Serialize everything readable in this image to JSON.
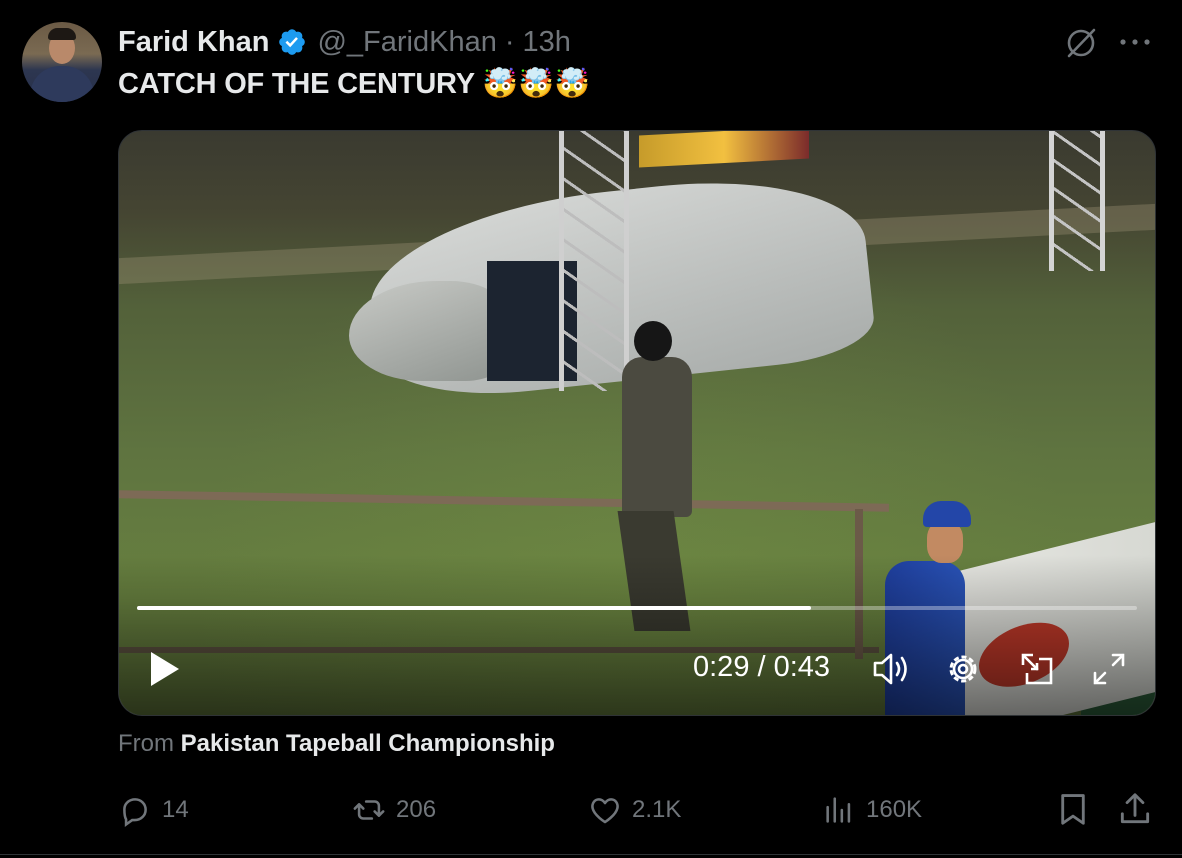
{
  "author": {
    "name": "Farid Khan",
    "handle": "@_FaridKhan",
    "separator": "·",
    "time": "13h",
    "verified": true
  },
  "tweet": {
    "text": "CATCH OF THE CENTURY",
    "emojis": "🤯🤯🤯"
  },
  "video": {
    "current_time": "0:29",
    "duration": "0:43",
    "timecode": "0:29 / 0:43",
    "progress_fraction": 0.674,
    "playing": false
  },
  "source": {
    "prefix": "From",
    "name": "Pakistan Tapeball Championship"
  },
  "actions": {
    "replies": "14",
    "reposts": "206",
    "likes": "2.1K",
    "views": "160K"
  },
  "icons": {
    "verified": "verified-badge-icon",
    "grok": "grok-icon",
    "more": "more-icon",
    "play": "play-icon",
    "volume": "volume-icon",
    "settings": "gear-icon",
    "pip": "picture-in-picture-icon",
    "fullscreen": "fullscreen-icon",
    "reply": "reply-icon",
    "repost": "repost-icon",
    "like": "heart-icon",
    "views": "views-icon",
    "bookmark": "bookmark-icon",
    "share": "share-icon"
  },
  "colors": {
    "background": "#000000",
    "text": "#e7e9ea",
    "muted": "#71767b",
    "verified": "#1d9bf0"
  }
}
